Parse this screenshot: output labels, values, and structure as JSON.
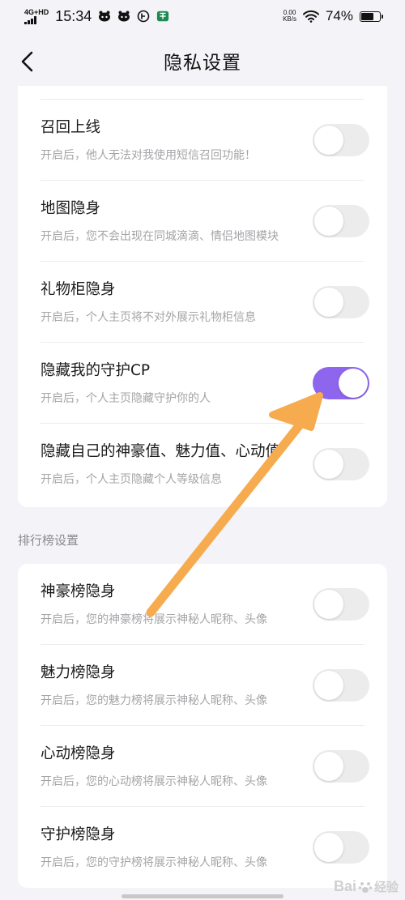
{
  "status_bar": {
    "network": "4G+HD",
    "time": "15:34",
    "app_icons": [
      "pet-icon",
      "pet-icon",
      "circle-badge-icon",
      "app-logo-icon"
    ],
    "speed_value": "0.00",
    "speed_unit": "KB/s",
    "battery": "74%",
    "battery_level": 0.74
  },
  "header": {
    "title": "隐私设置",
    "back_icon": "chevron-left-icon"
  },
  "privacy_settings": [
    {
      "title": "召回上线",
      "desc": "开启后，他人无法对我使用短信召回功能！",
      "on": false
    },
    {
      "title": "地图隐身",
      "desc": "开启后，您不会出现在同城滴滴、情侣地图模块",
      "on": false
    },
    {
      "title": "礼物柜隐身",
      "desc": "开启后，个人主页将不对外展示礼物柜信息",
      "on": false
    },
    {
      "title": "隐藏我的守护CP",
      "desc": "开启后，个人主页隐藏守护你的人",
      "on": true
    },
    {
      "title": "隐藏自己的神豪值、魅力值、心动值",
      "desc": "开启后，个人主页隐藏个人等级信息",
      "on": false
    }
  ],
  "leaderboard_section": {
    "label": "排行榜设置",
    "items": [
      {
        "title": "神豪榜隐身",
        "desc": "开启后，您的神豪榜将展示神秘人昵称、头像",
        "on": false
      },
      {
        "title": "魅力榜隐身",
        "desc": "开启后，您的魅力榜将展示神秘人昵称、头像",
        "on": false
      },
      {
        "title": "心动榜隐身",
        "desc": "开启后，您的心动榜将展示神秘人昵称、头像",
        "on": false
      },
      {
        "title": "守护榜隐身",
        "desc": "开启后，您的守护榜将展示神秘人昵称、头像",
        "on": false
      }
    ]
  },
  "colors": {
    "toggle_on": "#8e66ee",
    "toggle_off": "#ececec",
    "annotation_arrow": "#f6ab4f",
    "background": "#f4f4f8"
  },
  "watermark": {
    "brand": "Bai",
    "paw": "paw-icon",
    "suffix": "经验"
  }
}
